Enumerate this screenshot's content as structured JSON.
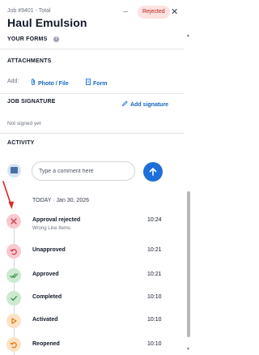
{
  "header": {
    "subtitle": "Job #9401 - Total",
    "title": "Haul Emulsion",
    "minimize_glyph": "–",
    "status_badge": "Rejected",
    "close_glyph": "✕"
  },
  "sections": {
    "forms": {
      "heading": "YOUR FORMS",
      "info_glyph": "i"
    },
    "attachments": {
      "heading": "ATTACHMENTS",
      "add_label": "Add:",
      "photo_file_label": "Photo / File",
      "form_label": "Form"
    },
    "signature": {
      "heading": "JOB SIGNATURE",
      "add_signature_label": "Add signature",
      "status": "Not signed yet"
    },
    "activity": {
      "heading": "ACTIVITY",
      "comment_placeholder": "Type a comment here",
      "date_heading": "TODAY · Jan 30, 2026",
      "events": [
        {
          "title": "Approval rejected",
          "subtitle": "Wrong Line Items",
          "time": "10:24",
          "status": "rejected",
          "color": "#f9c9cf",
          "icon": "close-icon"
        },
        {
          "title": "Unapproved",
          "time": "10:21",
          "status": "unapproved",
          "color": "#f9c9cf",
          "icon": "undo-icon"
        },
        {
          "title": "Approved",
          "time": "10:21",
          "status": "approved",
          "color": "#cde9cf",
          "icon": "double-check-icon"
        },
        {
          "title": "Completed",
          "time": "10:10",
          "status": "completed",
          "color": "#cde9cf",
          "icon": "check-icon"
        },
        {
          "title": "Activated",
          "time": "10:10",
          "status": "activated",
          "color": "#fde2c4",
          "icon": "play-icon"
        },
        {
          "title": "Reopened",
          "time": "10:10",
          "status": "reopened",
          "color": "#fde2c4",
          "icon": "reopen-icon"
        }
      ]
    }
  },
  "colors": {
    "accent": "#1e6fd9",
    "rejected_badge_bg": "#fde2e2",
    "rejected_text": "#b42318",
    "annotation_arrow": "#e02424"
  },
  "scrollbar": {
    "up_glyph": "▲",
    "down_glyph": "▼"
  }
}
